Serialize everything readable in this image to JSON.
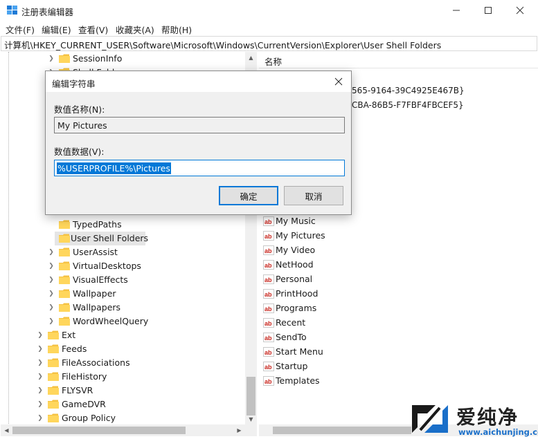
{
  "window": {
    "title": "注册表编辑器",
    "controls": [
      "minimize-icon",
      "maximize-icon",
      "close-icon"
    ]
  },
  "menu": [
    "文件(F)",
    "编辑(E)",
    "查看(V)",
    "收藏夹(A)",
    "帮助(H)"
  ],
  "address": "计算机\\HKEY_CURRENT_USER\\Software\\Microsoft\\Windows\\CurrentVersion\\Explorer\\User Shell Folders",
  "tree": {
    "top_partial": [
      "SessionInfo",
      "Shell Folders"
    ],
    "items": [
      {
        "label": "TypedPaths",
        "expandable": false
      },
      {
        "label": "User Shell Folders",
        "expandable": false,
        "selected": true
      },
      {
        "label": "UserAssist",
        "expandable": true
      },
      {
        "label": "VirtualDesktops",
        "expandable": true
      },
      {
        "label": "VisualEffects",
        "expandable": true
      },
      {
        "label": "Wallpaper",
        "expandable": true
      },
      {
        "label": "Wallpapers",
        "expandable": true
      },
      {
        "label": "WordWheelQuery",
        "expandable": true
      }
    ],
    "parent_items": [
      {
        "label": "Ext",
        "expandable": true
      },
      {
        "label": "Feeds",
        "expandable": true
      },
      {
        "label": "FileAssociations",
        "expandable": true
      },
      {
        "label": "FileHistory",
        "expandable": true
      },
      {
        "label": "FLYSVR",
        "expandable": true
      },
      {
        "label": "GameDVR",
        "expandable": true
      },
      {
        "label": "Group Policy",
        "expandable": true
      }
    ]
  },
  "values_pane": {
    "column_name": "名称",
    "partial_rows": [
      "565-9164-39C4925E467B}",
      "CBA-86B5-F7FBF4FBCEF5}"
    ],
    "rows": [
      "My Music",
      "My Pictures",
      "My Video",
      "NetHood",
      "Personal",
      "PrintHood",
      "Programs",
      "Recent",
      "SendTo",
      "Start Menu",
      "Startup",
      "Templates"
    ]
  },
  "dialog": {
    "title": "编辑字符串",
    "name_label": "数值名称(N):",
    "name_value": "My Pictures",
    "data_label": "数值数据(V):",
    "data_value": "%USERPROFILE%\\Pictures",
    "ok_label": "确定",
    "cancel_label": "取消"
  },
  "watermark": {
    "text": "爱纯净",
    "url": "www.aichunjing.com"
  },
  "colors": {
    "selection": "#0078d7",
    "folder": "#f5c242",
    "ab_icon": "#c8241c"
  }
}
